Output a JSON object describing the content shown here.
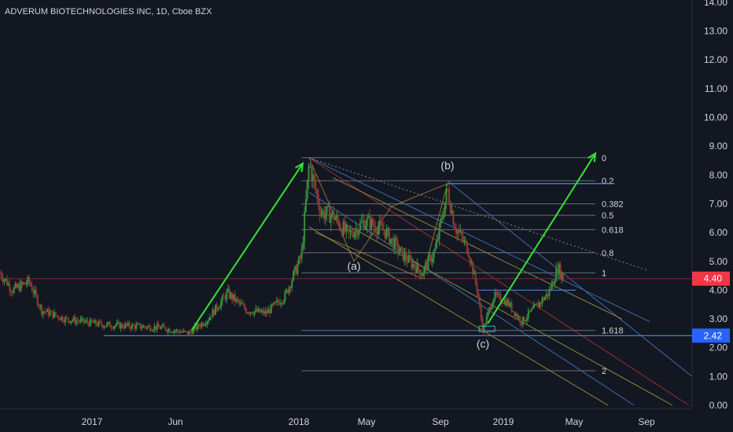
{
  "header": {
    "title": "ADVERUM BIOTECHNOLOGIES INC, 1D, Cboe BZX"
  },
  "colors": {
    "background": "#131722",
    "candle_up": "#3a8f3a",
    "candle_down": "#8e3a32",
    "arrow": "#36e336",
    "support_line": "#4a90e2",
    "resistance_line": "#2bb8c4",
    "price_badge_current": "#f23645",
    "price_badge_support": "#2962ff"
  },
  "chart_data": {
    "type": "candlestick",
    "symbol": "ADVERUM BIOTECHNOLOGIES INC",
    "interval": "1D",
    "exchange": "Cboe BZX",
    "x_ticks": [
      "2017",
      "Jun",
      "2018",
      "May",
      "Sep",
      "2019",
      "May",
      "Sep"
    ],
    "y_ticks": [
      "14.00",
      "13.00",
      "12.00",
      "11.00",
      "10.00",
      "9.00",
      "8.00",
      "7.00",
      "6.00",
      "5.00",
      "4.00",
      "3.00",
      "2.00",
      "1.00",
      "0.00"
    ],
    "ylim": [
      0,
      14
    ],
    "x_axis_dates": [
      "2016-09-20",
      "2019-09-20"
    ],
    "current_price": "4.40",
    "support_price": "2.42",
    "fib_levels": [
      {
        "label": "0",
        "value": 8.6
      },
      {
        "label": "0.2",
        "value": 7.8
      },
      {
        "label": "0.382",
        "value": 7.0
      },
      {
        "label": "0.5",
        "value": 6.6
      },
      {
        "label": "0.618",
        "value": 6.1
      },
      {
        "label": "0.8",
        "value": 5.3
      },
      {
        "label": "1",
        "value": 4.6
      },
      {
        "label": "1.618",
        "value": 2.6
      },
      {
        "label": "2",
        "value": 1.2
      }
    ],
    "wave_labels": [
      {
        "label": "(a)",
        "date": "2018-04-03",
        "value": 4.7
      },
      {
        "label": "(b)",
        "date": "2018-08-29",
        "value": 8.2
      },
      {
        "label": "(c)",
        "date": "2018-10-24",
        "value": 2.0
      }
    ],
    "price_path": [
      {
        "date": "2016-09-20",
        "value": 4.6
      },
      {
        "date": "2016-10-10",
        "value": 4.0
      },
      {
        "date": "2016-11-05",
        "value": 4.3
      },
      {
        "date": "2016-11-25",
        "value": 3.3
      },
      {
        "date": "2017-01-01",
        "value": 3.0
      },
      {
        "date": "2017-03-01",
        "value": 2.8
      },
      {
        "date": "2017-06-01",
        "value": 2.7
      },
      {
        "date": "2017-07-15",
        "value": 2.5
      },
      {
        "date": "2017-08-15",
        "value": 3.0
      },
      {
        "date": "2017-09-15",
        "value": 3.9
      },
      {
        "date": "2017-10-15",
        "value": 3.3
      },
      {
        "date": "2017-11-15",
        "value": 3.2
      },
      {
        "date": "2017-12-15",
        "value": 3.8
      },
      {
        "date": "2018-01-10",
        "value": 5.2
      },
      {
        "date": "2018-01-22",
        "value": 8.4
      },
      {
        "date": "2018-02-10",
        "value": 6.7
      },
      {
        "date": "2018-03-01",
        "value": 6.6
      },
      {
        "date": "2018-03-25",
        "value": 5.9
      },
      {
        "date": "2018-04-20",
        "value": 6.4
      },
      {
        "date": "2018-05-20",
        "value": 6.1
      },
      {
        "date": "2018-06-20",
        "value": 5.2
      },
      {
        "date": "2018-07-20",
        "value": 4.6
      },
      {
        "date": "2018-08-10",
        "value": 5.4
      },
      {
        "date": "2018-08-29",
        "value": 7.5
      },
      {
        "date": "2018-09-10",
        "value": 6.2
      },
      {
        "date": "2018-10-01",
        "value": 5.4
      },
      {
        "date": "2018-10-15",
        "value": 4.0
      },
      {
        "date": "2018-10-24",
        "value": 2.6
      },
      {
        "date": "2018-11-10",
        "value": 3.8
      },
      {
        "date": "2018-12-01",
        "value": 3.6
      },
      {
        "date": "2018-12-24",
        "value": 2.9
      },
      {
        "date": "2019-01-15",
        "value": 3.4
      },
      {
        "date": "2019-02-05",
        "value": 3.9
      },
      {
        "date": "2019-02-20",
        "value": 4.8
      },
      {
        "date": "2019-02-28",
        "value": 4.4
      }
    ]
  }
}
